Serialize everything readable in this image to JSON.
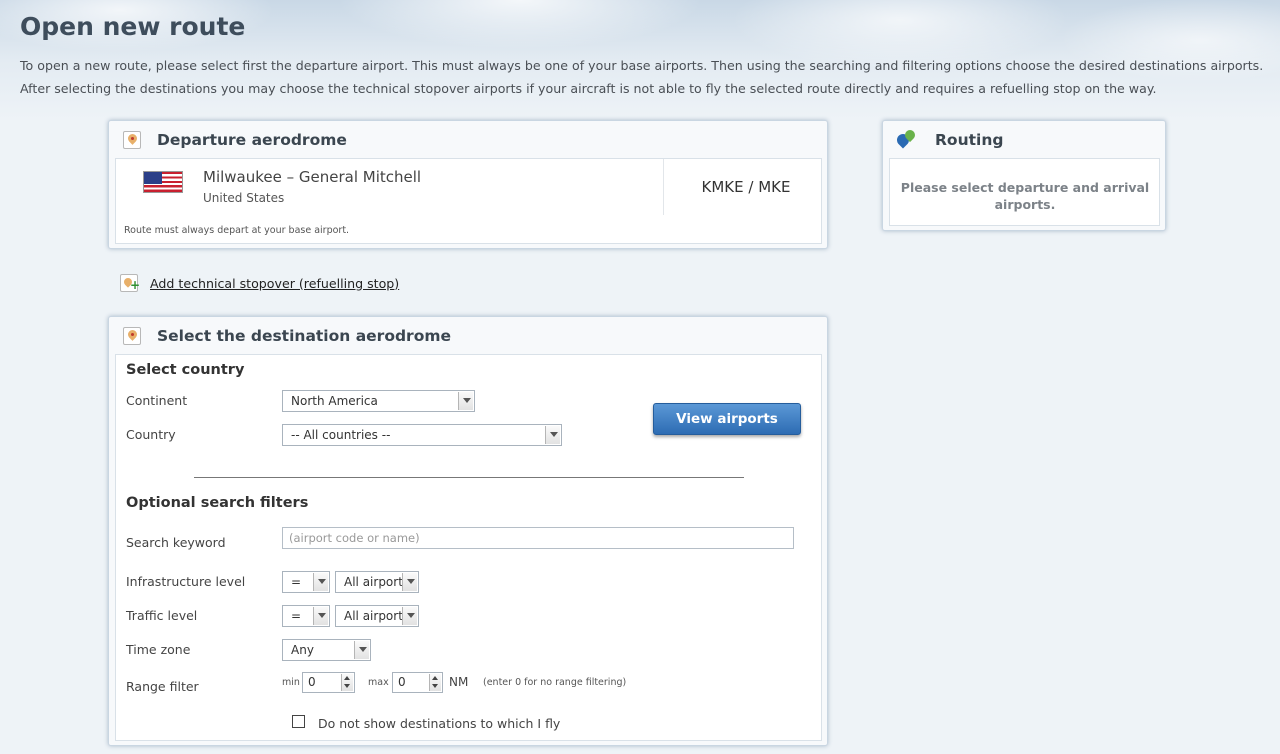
{
  "page": {
    "title": "Open new route",
    "intro_line1": "To open a new route, please select first the departure airport. This must always be one of your base airports. Then using the searching and filtering options choose the desired destinations airports.",
    "intro_line2": "After selecting the destinations you may choose the technical stopover airports if your aircraft is not able to fly the selected route directly and requires a refuelling stop on the way."
  },
  "departure": {
    "title": "Departure aerodrome",
    "airport_name": "Milwaukee – General Mitchell",
    "country": "United States",
    "codes": "KMKE / MKE",
    "note": "Route must always depart at your base airport.",
    "flag_icon": "us-flag-icon"
  },
  "routing": {
    "title": "Routing",
    "message": "Please select departure and arrival airports."
  },
  "add_stopover": {
    "label": "Add technical stopover (refuelling stop)"
  },
  "destination": {
    "title": "Select the destination aerodrome",
    "select_country_heading": "Select country",
    "continent_label": "Continent",
    "continent_value": "North America",
    "country_label": "Country",
    "country_value": "-- All countries --",
    "view_airports_button": "View airports",
    "optional_heading": "Optional search filters",
    "search_label": "Search keyword",
    "search_placeholder": "(airport code or name)",
    "search_value": "",
    "infra_label": "Infrastructure level",
    "infra_op": "=",
    "infra_value": "All airports",
    "traffic_label": "Traffic level",
    "traffic_op": "=",
    "traffic_value": "All airports",
    "timezone_label": "Time zone",
    "timezone_value": "Any",
    "range_label": "Range filter",
    "range_min_label": "min",
    "range_min_value": "0",
    "range_max_label": "max",
    "range_max_value": "0",
    "range_unit": "NM",
    "range_hint": "(enter 0 for no range filtering)",
    "dont_show_label": "Do not show destinations to which I fly",
    "dont_show_checked": false
  }
}
